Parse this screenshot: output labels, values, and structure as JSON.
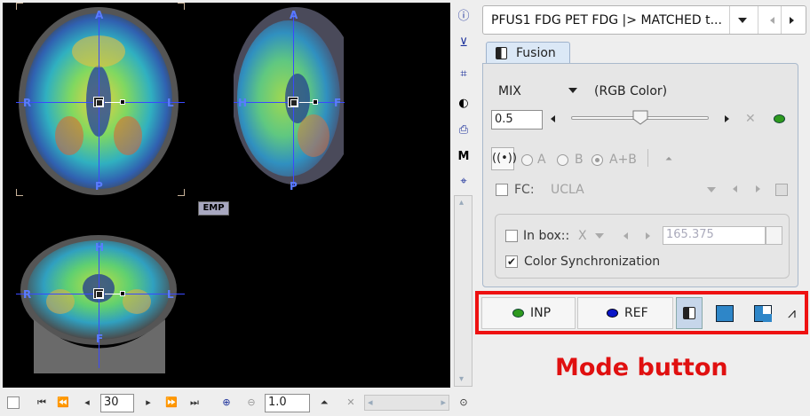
{
  "viewer": {
    "orientation_labels": {
      "transaxial": {
        "top": "A",
        "bottom": "P",
        "left": "R",
        "right": "L"
      },
      "sagittal": {
        "top": "A",
        "bottom": "P",
        "left": "H",
        "right": "F"
      },
      "coronal": {
        "top": "H",
        "bottom": "F",
        "left": "R",
        "right": "L"
      }
    },
    "emp_badge": "EMP"
  },
  "bottom_bar": {
    "slice_value": "30",
    "zoom_value": "1.0"
  },
  "selector": {
    "text": "PFUS1 FDG PET FDG |> MATCHED t..."
  },
  "fusion_tab": {
    "label": "Fusion",
    "mode": "MIX",
    "mode_desc": "(RGB Color)",
    "mix_value": "0.5",
    "mix_fraction": 0.5,
    "radio_a": "A",
    "radio_b": "B",
    "radio_ab": "A+B",
    "radio_selected": "A+B",
    "fc_label": "FC:",
    "fc_value": "UCLA",
    "fc_checked": false,
    "inbox_label": "In box::",
    "inbox_checked": false,
    "inbox_axis": "X",
    "inbox_value": "165.375",
    "color_sync_label": "Color Synchronization",
    "color_sync_checked": true
  },
  "mode_bar": {
    "inp_label": "INP",
    "ref_label": "REF",
    "inp_color": "#2e9a1e",
    "ref_color": "#0a16c8",
    "highlight_color": "#ee1111"
  },
  "caption": "Mode button",
  "colors": {
    "crosshair": "#3a49ff",
    "label": "#5a7cff",
    "panel_border": "#a9b9cc",
    "tab_bg": "#dbe8f6"
  }
}
